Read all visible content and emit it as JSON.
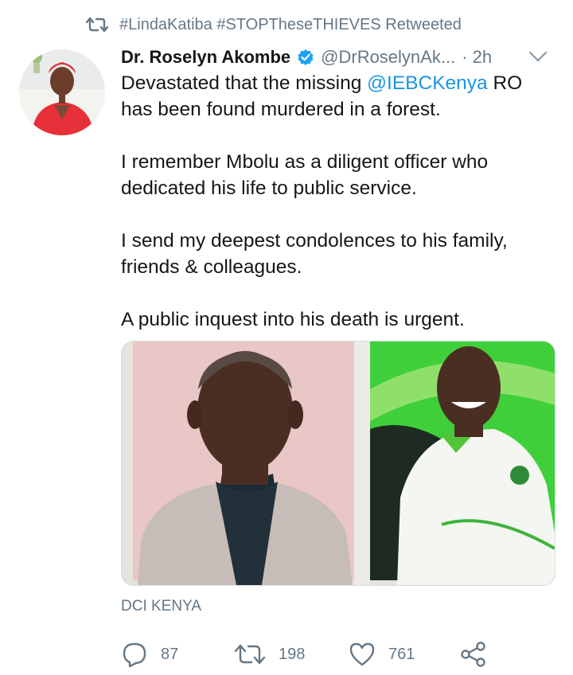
{
  "retweet_context": {
    "icon": "retweet-icon",
    "text": "#LindaKatiba #STOPTheseTHIEVES Retweeted"
  },
  "tweet": {
    "author_name": "Dr. Roselyn Akombe",
    "verified": true,
    "handle": "@DrRoselynAk...",
    "separator": "·",
    "time": "2h",
    "body": {
      "line1_before": "Devastated that the missing ",
      "mention": "@IEBCKenya",
      "line1_after": " RO has been found murdered in a forest.",
      "paragraph2": "I remember Mbolu as a diligent officer who dedicated his life to public service.",
      "paragraph3": "I send my deepest condolences to his family, friends & colleagues.",
      "paragraph4": "A public inquest into his death is urgent."
    },
    "media_caption": "DCI KENYA",
    "stats": {
      "replies": "87",
      "retweets": "198",
      "likes": "761"
    }
  },
  "colors": {
    "accent": "#1b95e0",
    "secondary_text": "#657786",
    "primary_text": "#14171a",
    "verified": "#1da1f2",
    "green_backdrop": "#3fcf3a"
  }
}
